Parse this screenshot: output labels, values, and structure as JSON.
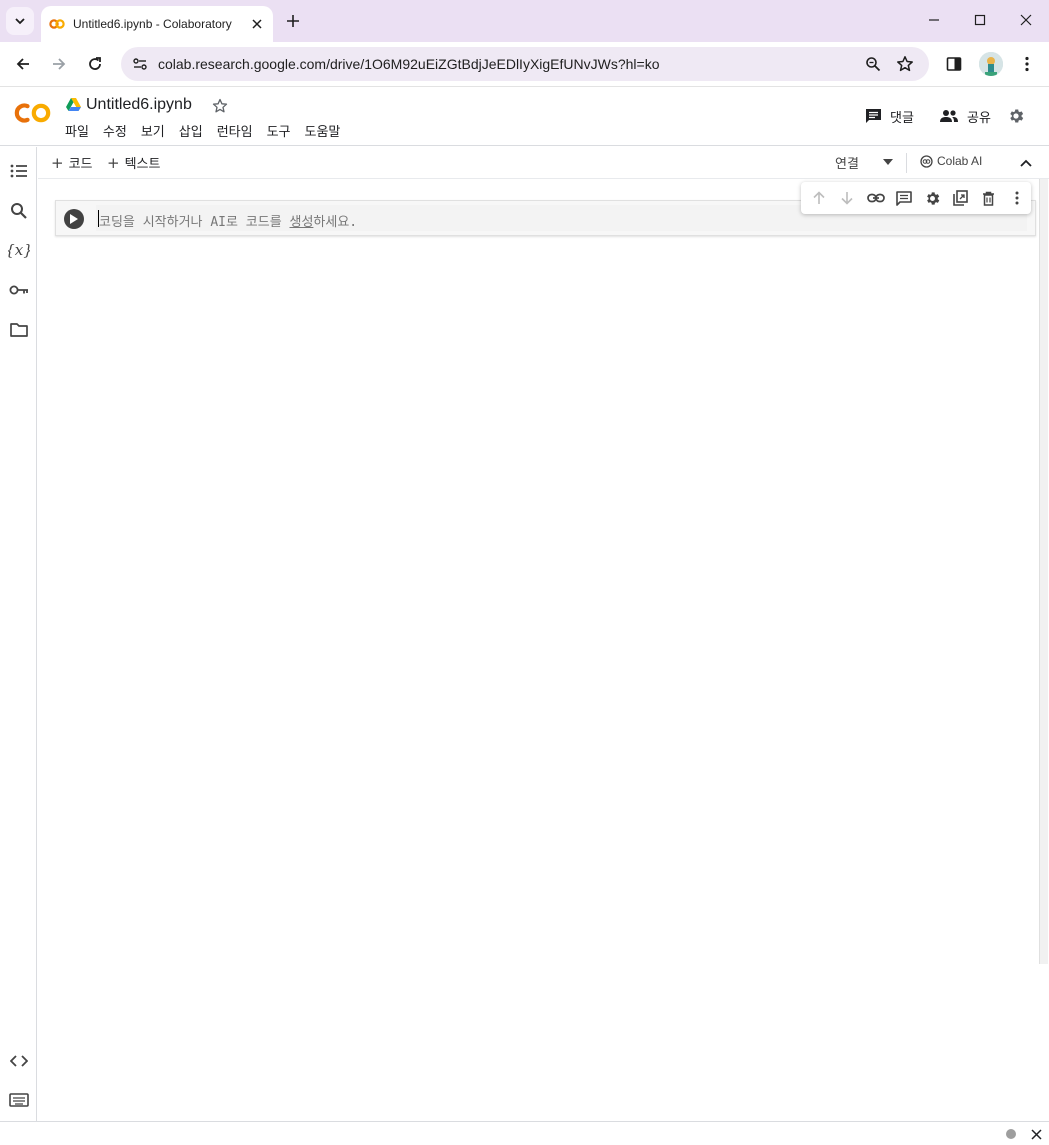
{
  "browser": {
    "tab_title": "Untitled6.ipynb - Colaboratory",
    "url": "colab.research.google.com/drive/1O6M92uEiZGtBdjJeEDlIyXigEfUNvJWs?hl=ko"
  },
  "colab": {
    "logo_text": "CO",
    "notebook_title": "Untitled6.ipynb",
    "menu": [
      "파일",
      "수정",
      "보기",
      "삽입",
      "런타임",
      "도구",
      "도움말"
    ],
    "comments_label": "댓글",
    "share_label": "공유"
  },
  "notebook_toolbar": {
    "add_code_label": "코드",
    "add_text_label": "텍스트",
    "connect_label": "연결",
    "colab_ai_label": "Colab AI"
  },
  "cell": {
    "placeholder_before": "코딩을 시작하거나 AI로 코드를 ",
    "placeholder_link": "생성",
    "placeholder_after": "하세요."
  },
  "colors": {
    "tabbar_bg": "#ebe0f3",
    "colab_orange": "#f9ab00",
    "colab_orange_dark": "#e8710a"
  }
}
